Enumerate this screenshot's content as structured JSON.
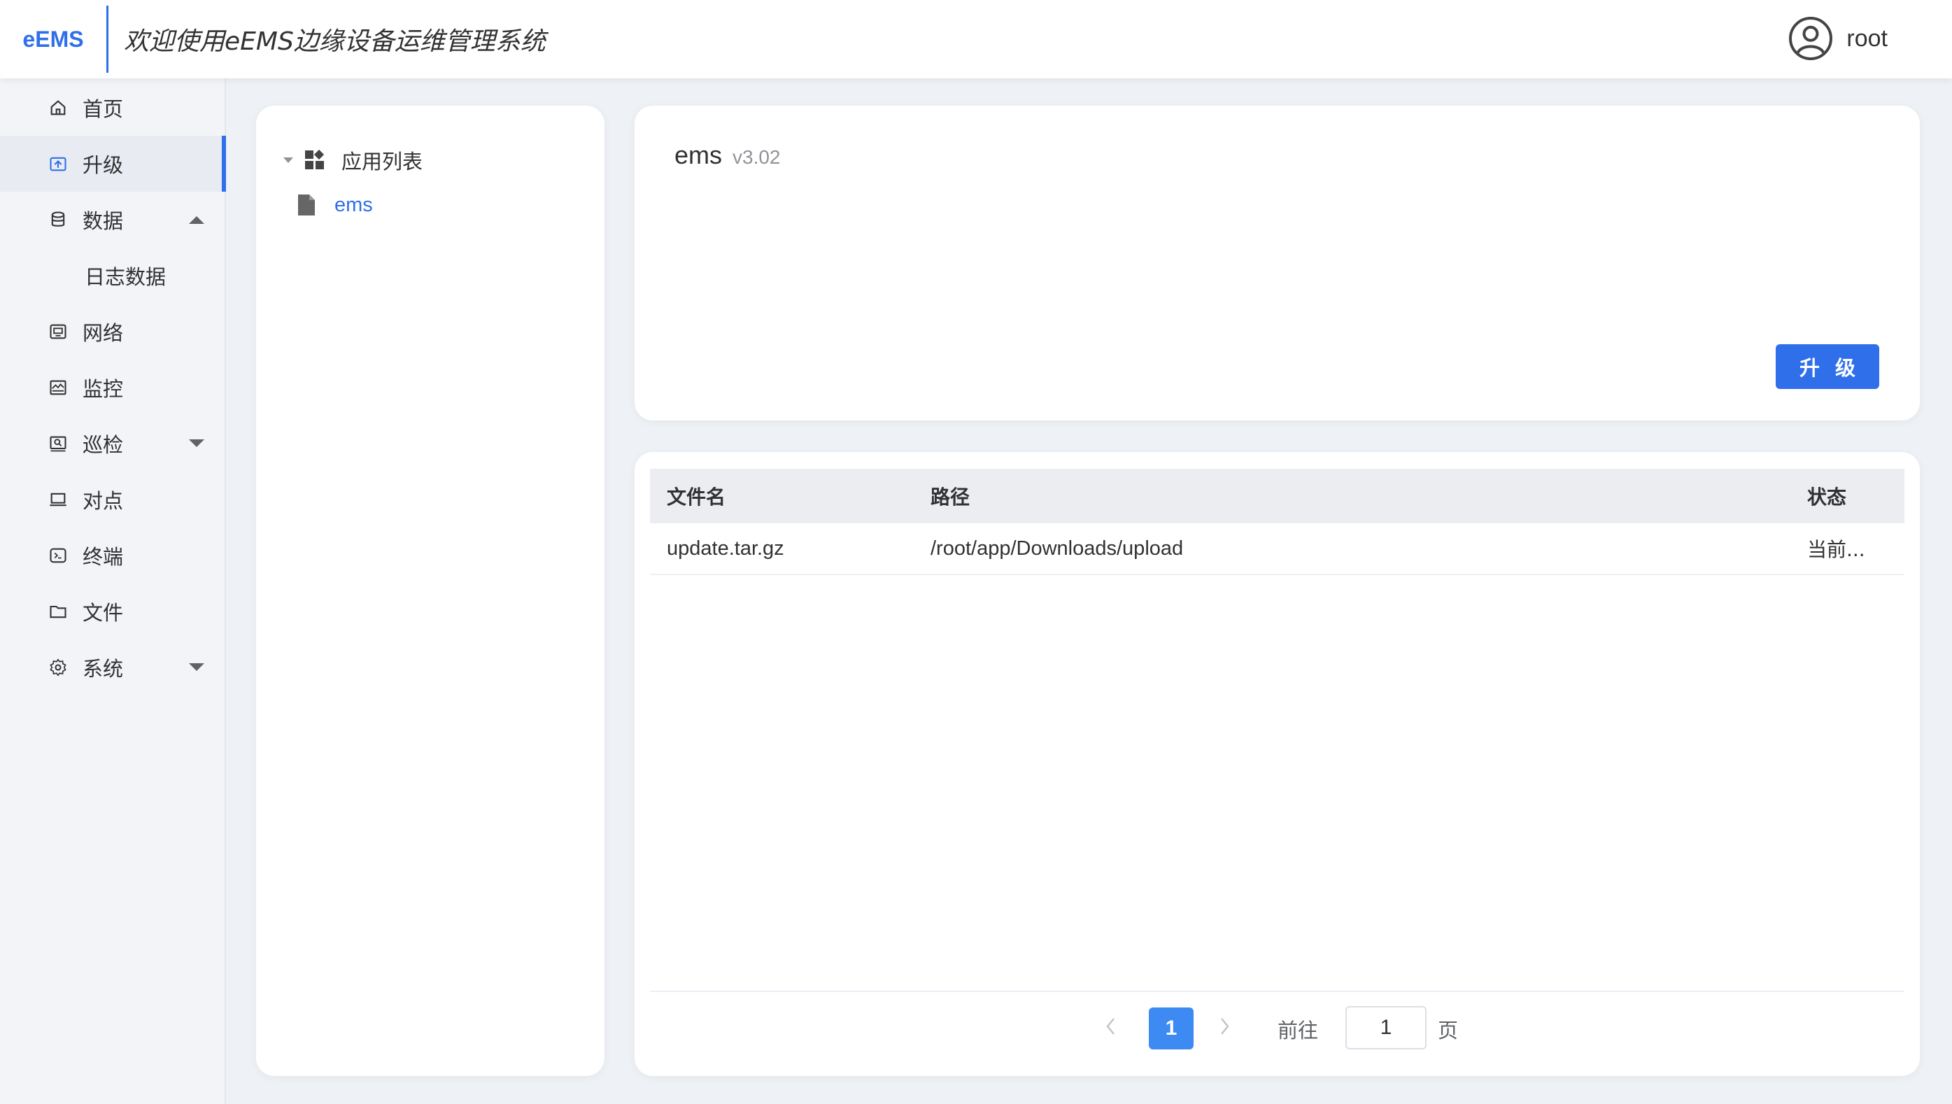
{
  "header": {
    "logo": "eEMS",
    "title": "欢迎使用eEMS边缘设备运维管理系统",
    "username": "root"
  },
  "sidebar": {
    "items": [
      {
        "label": "首页",
        "icon": "home-icon"
      },
      {
        "label": "升级",
        "icon": "upgrade-icon",
        "active": true
      },
      {
        "label": "数据",
        "icon": "database-icon",
        "expanded": true
      },
      {
        "label": "日志数据",
        "sub": true
      },
      {
        "label": "网络",
        "icon": "network-icon"
      },
      {
        "label": "监控",
        "icon": "monitor-icon"
      },
      {
        "label": "巡检",
        "icon": "inspection-icon",
        "expandable": true
      },
      {
        "label": "对点",
        "icon": "laptop-icon"
      },
      {
        "label": "终端",
        "icon": "terminal-icon"
      },
      {
        "label": "文件",
        "icon": "folder-icon"
      },
      {
        "label": "系统",
        "icon": "gear-icon",
        "expandable": true
      }
    ]
  },
  "tree": {
    "root_label": "应用列表",
    "children": [
      {
        "label": "ems"
      }
    ]
  },
  "app_info": {
    "name": "ems",
    "version": "v3.02",
    "upgrade_button": "升级"
  },
  "files_table": {
    "columns": [
      "文件名",
      "路径",
      "状态"
    ],
    "rows": [
      {
        "name": "update.tar.gz",
        "path": "/root/app/Downloads/upload",
        "status": "当前..."
      }
    ]
  },
  "pagination": {
    "current_page": "1",
    "goto_label": "前往",
    "goto_value": "1",
    "page_suffix": "页"
  },
  "colors": {
    "accent": "#2f6fea",
    "page_button": "#3d8bf2",
    "background": "#eef1f5"
  }
}
